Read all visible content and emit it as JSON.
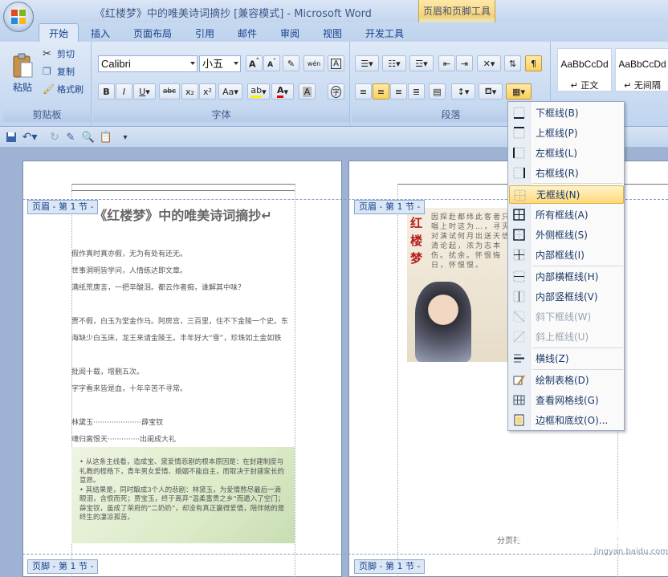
{
  "window": {
    "title": "《红楼梦》中的唯美诗词摘抄 [兼容模式] - Microsoft Word"
  },
  "context_tab": {
    "group": "页眉和页脚工具",
    "tab": "设计"
  },
  "tabs": [
    "开始",
    "插入",
    "页面布局",
    "引用",
    "邮件",
    "审阅",
    "视图",
    "开发工具"
  ],
  "clipboard": {
    "paste": "粘贴",
    "cut": "剪切",
    "copy": "复制",
    "format_painter": "格式刷",
    "group_label": "剪贴板"
  },
  "font": {
    "name": "Calibri",
    "size": "小五",
    "group_label": "字体",
    "phonetic": "wén",
    "char_border": "A",
    "bold": "B",
    "italic": "I",
    "underline": "U",
    "strike": "abc",
    "sub": "x₂",
    "sup": "x²",
    "case": "Aa",
    "char_shade": "A",
    "enclose": "字"
  },
  "paragraph": {
    "group_label": "段落"
  },
  "styles": [
    {
      "sample": "AaBbCcDd",
      "name": "↵ 正文"
    },
    {
      "sample": "AaBbCcDd",
      "name": "↵ 无间隔"
    }
  ],
  "pages": {
    "header_tag": "页眉 - 第 1 节 -",
    "footer_tag": "页脚 - 第 1 节 -",
    "footer_label": "分页符",
    "doc_title": "《红楼梦》中的唯美诗词摘抄↵",
    "lines": [
      "假作真时真亦假，无为有处有还无。",
      "世事洞明皆学问，人情练达即文章。",
      "满纸荒唐言，一把辛酸泪。都云作者痴，谁解其中味？",
      "贾不假，白玉为堂金作马。阿房宫，三百里，住不下金陵一个史。东",
      "海缺少白玉床，龙王来请金陵王。丰年好大“雪”，珍珠如土金如铁",
      "批阅十载，增删五次。",
      "字字看来皆是血，十年辛苦不寻常。",
      "林黛玉·····················薛宝钗",
      "魂归离恨天··············出闺成大礼"
    ],
    "image_text": "• 从这条主线看，造成宝、黛爱情悲剧的根本原因是：在封建制度与礼教的桎梏下，青年男女爱情、婚姻不能自主，而取决于封建家长的意愿。\n• 其结果是，同时酿成3个人的悲剧：林黛玉，为爱情熬尽最后一滴眼泪，含恨而死；贾宝玉，终于离弃“温柔富贵之乡”而遁入了空门；薛宝钗，虽成了荣府的“二奶奶”，却没有真正赢得爱情，陪伴她的是终生的凄凉孤苦。",
    "poster_title": "红楼梦",
    "poster_text": "因探赴都纬此客者只唱上时这为…，寻灭对演试何月出送天信清论起，浓为志本伤。扰余。怀恨悔日，怀恨恨。"
  },
  "border_menu": {
    "items": [
      {
        "label": "下框线(B)",
        "icon": "border-bottom-icon",
        "enabled": true
      },
      {
        "label": "上框线(P)",
        "icon": "border-top-icon",
        "enabled": true
      },
      {
        "label": "左框线(L)",
        "icon": "border-left-icon",
        "enabled": true
      },
      {
        "label": "右框线(R)",
        "icon": "border-right-icon",
        "enabled": true
      },
      {
        "label": "无框线(N)",
        "icon": "no-border-icon",
        "enabled": true,
        "highlighted": true
      },
      {
        "label": "所有框线(A)",
        "icon": "all-borders-icon",
        "enabled": true
      },
      {
        "label": "外侧框线(S)",
        "icon": "outside-borders-icon",
        "enabled": true
      },
      {
        "label": "内部框线(I)",
        "icon": "inside-borders-icon",
        "enabled": true
      },
      {
        "label": "内部横框线(H)",
        "icon": "inside-horizontal-border-icon",
        "enabled": true
      },
      {
        "label": "内部竖框线(V)",
        "icon": "inside-vertical-border-icon",
        "enabled": true
      },
      {
        "label": "斜下框线(W)",
        "icon": "diagonal-down-border-icon",
        "enabled": false
      },
      {
        "label": "斜上框线(U)",
        "icon": "diagonal-up-border-icon",
        "enabled": false
      },
      {
        "label": "横线(Z)",
        "icon": "horizontal-line-icon",
        "enabled": true
      },
      {
        "label": "绘制表格(D)",
        "icon": "draw-table-icon",
        "enabled": true
      },
      {
        "label": "查看网格线(G)",
        "icon": "view-gridlines-icon",
        "enabled": true
      },
      {
        "label": "边框和底纹(O)...",
        "icon": "borders-shading-icon",
        "enabled": true
      }
    ]
  },
  "watermark": {
    "brand": "Baidu 经验",
    "sub": "jingyan.baidu.com"
  }
}
